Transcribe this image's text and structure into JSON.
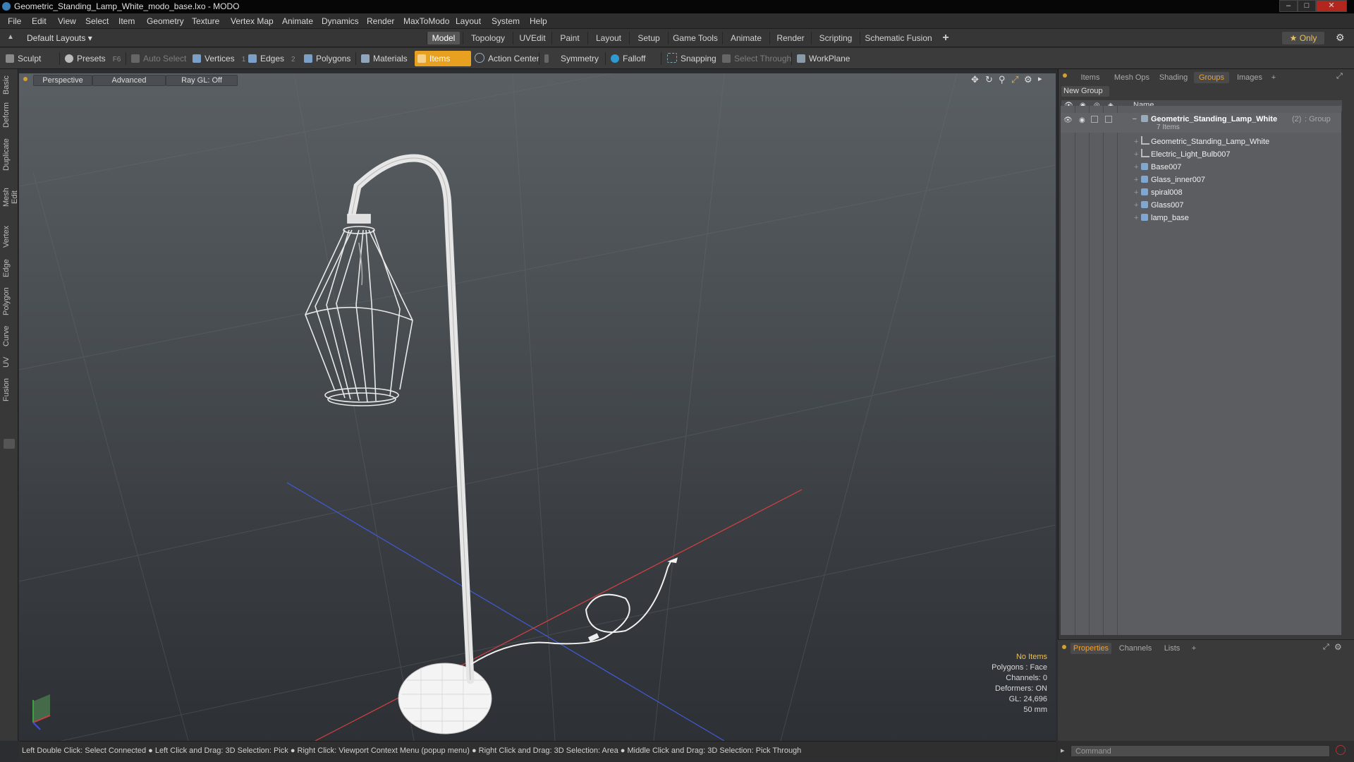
{
  "window": {
    "title": "Geometric_Standing_Lamp_White_modo_base.lxo - MODO"
  },
  "menu": [
    "File",
    "Edit",
    "View",
    "Select",
    "Item",
    "Geometry",
    "Texture",
    "Vertex Map",
    "Animate",
    "Dynamics",
    "Render",
    "MaxToModo",
    "Layout",
    "System",
    "Help"
  ],
  "layout_bar": {
    "layout_name": "Default Layouts ▾",
    "tabs": [
      "Model",
      "Topology",
      "UVEdit",
      "Paint",
      "Layout",
      "Setup",
      "Game Tools",
      "Animate",
      "Render",
      "Scripting",
      "Schematic Fusion"
    ],
    "active_tab": "Model",
    "add": "+",
    "only_label": "★  Only"
  },
  "toolbar": {
    "sculpt": "Sculpt",
    "presets": "Presets",
    "presets_key": "F6",
    "auto_select": "Auto Select",
    "vertices": "Vertices",
    "vertices_key": "1",
    "edges": "Edges",
    "edges_key": "2",
    "polygons": "Polygons",
    "materials": "Materials",
    "items": "Items",
    "action_center": "Action Center",
    "symmetry": "Symmetry",
    "falloff": "Falloff",
    "snapping": "Snapping",
    "select_through": "Select Through",
    "workplane": "WorkPlane"
  },
  "left_tabs": [
    "Basic",
    "Deform",
    "Duplicate",
    "Mesh Edit",
    "Vertex",
    "Edge",
    "Polygon",
    "Curve",
    "UV",
    "Fusion"
  ],
  "viewport": {
    "view": "Perspective",
    "shading": "Advanced",
    "raygl": "Ray GL: Off",
    "info": {
      "items": "No Items",
      "polygons": "Polygons : Face",
      "channels": "Channels: 0",
      "deformers": "Deformers: ON",
      "gl": "GL: 24,696",
      "scale": "50 mm"
    }
  },
  "status": "Left Double Click: Select Connected ● Left Click and Drag: 3D Selection: Pick ● Right Click: Viewport Context Menu (popup menu) ● Right Click and Drag: 3D Selection: Area ● Middle Click and Drag: 3D Selection: Pick Through",
  "right_panel": {
    "tabs": [
      "Items",
      "Mesh Ops",
      "Shading",
      "Groups",
      "Images"
    ],
    "active_tab": "Groups",
    "new_group": "New Group",
    "column_name": "Name",
    "group": {
      "name": "Geometric_Standing_Lamp_White",
      "count": "(2)",
      "type": ": Group",
      "sub": "7 Items"
    },
    "items": [
      {
        "name": "Geometric_Standing_Lamp_White",
        "icon": "locator-icon"
      },
      {
        "name": "Electric_Light_Bulb007",
        "icon": "locator-icon"
      },
      {
        "name": "Base007",
        "icon": "mesh-icon"
      },
      {
        "name": "Glass_inner007",
        "icon": "mesh-icon"
      },
      {
        "name": "spiral008",
        "icon": "mesh-icon"
      },
      {
        "name": "Glass007",
        "icon": "mesh-icon"
      },
      {
        "name": "lamp_base",
        "icon": "mesh-icon"
      }
    ],
    "bottom_tabs": [
      "Properties",
      "Channels",
      "Lists"
    ],
    "bottom_active": "Properties",
    "command_placeholder": "Command"
  },
  "colors": {
    "accent": "#f0a030",
    "items_active": "#e8a020"
  }
}
